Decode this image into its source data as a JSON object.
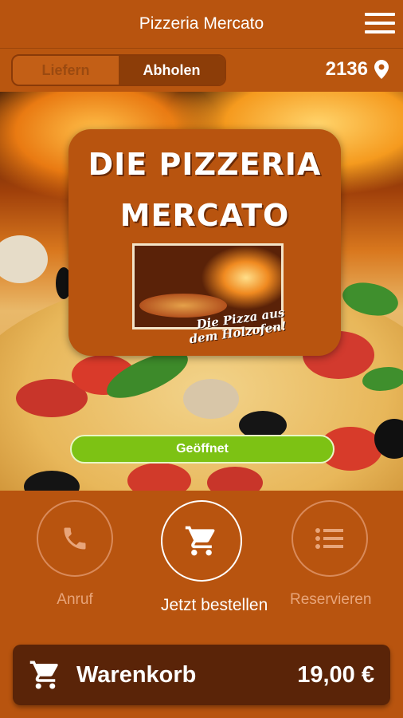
{
  "header": {
    "title": "Pizzeria Mercato",
    "menu_icon": "hamburger-menu-icon"
  },
  "delivery_toggle": {
    "options": [
      "Liefern",
      "Abholen"
    ],
    "selected": "Abholen"
  },
  "location": {
    "postal_code": "2136",
    "icon": "location-pin-icon"
  },
  "logo": {
    "line1": "DIE PIZZERIA",
    "line2": "MERCATO",
    "slogan_line1": "Die Pizza aus",
    "slogan_line2": "dem Holzofen!"
  },
  "status": {
    "label": "Geöffnet",
    "color": "#7dc214"
  },
  "actions": [
    {
      "label": "Anruf",
      "icon": "phone-icon"
    },
    {
      "label": "Jetzt bestellen",
      "icon": "shopping-cart-icon"
    },
    {
      "label": "Reservieren",
      "icon": "list-icon"
    }
  ],
  "cart": {
    "label": "Warenkorb",
    "total": "19,00 €",
    "icon": "shopping-cart-icon"
  },
  "colors": {
    "primary": "#b8540f",
    "dark": "#5a2408",
    "accent_green": "#7dc214"
  }
}
